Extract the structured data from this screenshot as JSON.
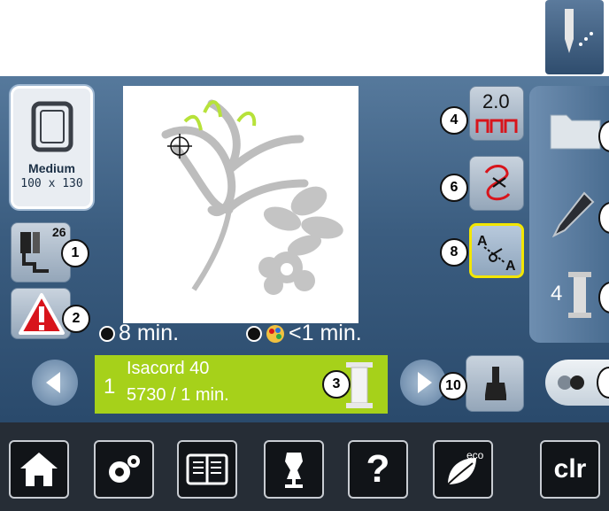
{
  "hoop": {
    "size_label": "Medium",
    "dimensions": "100 x 130"
  },
  "presser_foot": {
    "number": "26"
  },
  "stitch_length": {
    "value": "2.0"
  },
  "timers": {
    "total": "8 min.",
    "color_change": "<1 min."
  },
  "thread": {
    "index": "1",
    "brand": "Isacord 40",
    "code_time": "5730 / 1 min."
  },
  "needle_position": {
    "value": "4"
  },
  "badges": [
    "1",
    "2",
    "3",
    "4",
    "6",
    "8",
    "10"
  ],
  "bottom_bar": {
    "clr_label": "clr",
    "eco_label": "eco"
  },
  "colors": {
    "thread_panel": "#a6d11a",
    "accent_yellow": "#f3e600",
    "warning_red": "#d8141b"
  }
}
